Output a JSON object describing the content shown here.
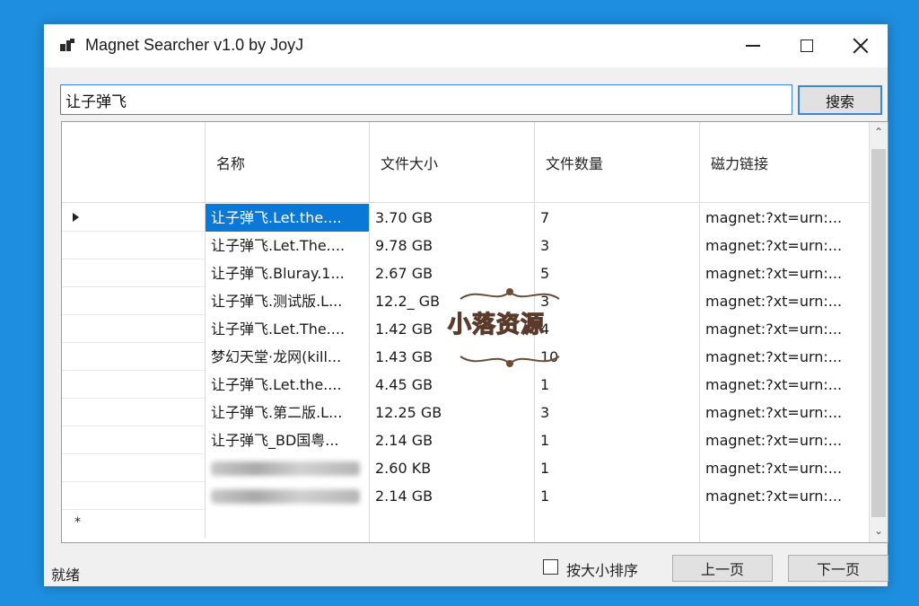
{
  "window": {
    "title": "Magnet Searcher v1.0 by JoyJ"
  },
  "search": {
    "value": "让子弹飞",
    "button_label": "搜索"
  },
  "grid": {
    "columns": [
      "名称",
      "文件大小",
      "文件数量",
      "磁力链接"
    ],
    "rows": [
      {
        "name": "让子弹飞.Let.the....",
        "size": "3.70 GB",
        "count": "7",
        "link": "magnet:?xt=urn:...",
        "selected": true,
        "current": true
      },
      {
        "name": "让子弹飞.Let.The....",
        "size": "9.78 GB",
        "count": "3",
        "link": "magnet:?xt=urn:..."
      },
      {
        "name": "让子弹飞.Bluray.1...",
        "size": "2.67 GB",
        "count": "5",
        "link": "magnet:?xt=urn:..."
      },
      {
        "name": "让子弹飞.测试版.L...",
        "size": "12.2_ GB",
        "count": "3",
        "link": "magnet:?xt=urn:..."
      },
      {
        "name": "让子弹飞.Let.The....",
        "size": "1.42 GB",
        "count": "4",
        "link": "magnet:?xt=urn:..."
      },
      {
        "name": "梦幻天堂·龙网(kill...",
        "size": "1.43 GB",
        "count": "10",
        "link": "magnet:?xt=urn:..."
      },
      {
        "name": "让子弹飞.Let.the....",
        "size": "4.45 GB",
        "count": "1",
        "link": "magnet:?xt=urn:..."
      },
      {
        "name": "让子弹飞.第二版.L...",
        "size": "12.25 GB",
        "count": "3",
        "link": "magnet:?xt=urn:..."
      },
      {
        "name": "让子弹飞_BD国粤...",
        "size": "2.14 GB",
        "count": "1",
        "link": "magnet:?xt=urn:..."
      },
      {
        "name": "",
        "size": "2.60 KB",
        "count": "1",
        "link": "magnet:?xt=urn:...",
        "blurred": true
      },
      {
        "name": "",
        "size": "2.14 GB",
        "count": "1",
        "link": "magnet:?xt=urn:...",
        "blurred": true
      }
    ],
    "new_row_marker": "*"
  },
  "status": {
    "text": "就绪"
  },
  "options": {
    "sort_by_size_label": "按大小排序",
    "sort_by_size_checked": false
  },
  "pagination": {
    "prev_label": "上一页",
    "next_label": "下一页"
  },
  "watermark": {
    "text": "小落资源"
  },
  "icons": {
    "app": "app-window-icon",
    "minimize": "minimize-icon",
    "maximize": "maximize-icon",
    "close": "close-icon"
  },
  "colors": {
    "desktop": "#1e8fe0",
    "selection": "#0a78d7",
    "focus_border": "#3b86d6"
  }
}
